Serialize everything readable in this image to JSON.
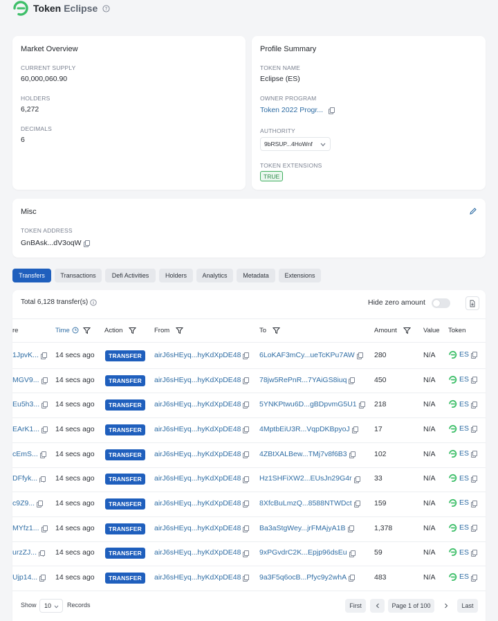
{
  "header": {
    "title_word1": "Token",
    "title_word2": "Eclipse",
    "help_icon": "question-circle-icon"
  },
  "market_overview": {
    "title": "Market Overview",
    "current_supply_label": "CURRENT SUPPLY",
    "current_supply": "60,000,060.90",
    "holders_label": "HOLDERS",
    "holders": "6,272",
    "decimals_label": "DECIMALS",
    "decimals": "6"
  },
  "profile_summary": {
    "title": "Profile Summary",
    "token_name_label": "TOKEN NAME",
    "token_name": "Eclipse (ES)",
    "owner_program_label": "OWNER PROGRAM",
    "owner_program": "Token 2022 Progr...",
    "authority_label": "AUTHORITY",
    "authority": "9bRSUP...4HoWnf",
    "token_extensions_label": "TOKEN EXTENSIONS",
    "token_extensions": "TRUE"
  },
  "misc": {
    "title": "Misc",
    "token_address_label": "TOKEN ADDRESS",
    "token_address": "GnBAsk...dV3oqW"
  },
  "tabs": [
    "Transfers",
    "Transactions",
    "Defi Activities",
    "Holders",
    "Analytics",
    "Metadata",
    "Extensions"
  ],
  "transfers": {
    "total": "Total 6,128 transfer(s)",
    "hide_zero": "Hide zero amount",
    "columns": {
      "signature": "re",
      "time": "Time",
      "action": "Action",
      "from": "From",
      "to": "To",
      "amount": "Amount",
      "value": "Value",
      "token": "Token"
    },
    "rows": [
      {
        "sig": "1JpvK...",
        "time": "14 secs ago",
        "action": "TRANSFER",
        "from": "airJ6sHEyq...hyKdXpDE48",
        "to": "6LoKAF3mCy...ueTcKPu7AW",
        "amount": "280",
        "value": "N/A",
        "token": "ES"
      },
      {
        "sig": "MGV9...",
        "time": "14 secs ago",
        "action": "TRANSFER",
        "from": "airJ6sHEyq...hyKdXpDE48",
        "to": "78jw5RePnR...7YAiGS8iuq",
        "amount": "450",
        "value": "N/A",
        "token": "ES"
      },
      {
        "sig": "Eu5h3...",
        "time": "14 secs ago",
        "action": "TRANSFER",
        "from": "airJ6sHEyq...hyKdXpDE48",
        "to": "5YNKPtwu6D...gBDpvmG5U1",
        "amount": "218",
        "value": "N/A",
        "token": "ES"
      },
      {
        "sig": "EArK1...",
        "time": "14 secs ago",
        "action": "TRANSFER",
        "from": "airJ6sHEyq...hyKdXpDE48",
        "to": "4MptbEiU3R...VqpDKBpyoJ",
        "amount": "17",
        "value": "N/A",
        "token": "ES"
      },
      {
        "sig": "cEmS...",
        "time": "14 secs ago",
        "action": "TRANSFER",
        "from": "airJ6sHEyq...hyKdXpDE48",
        "to": "4ZBtXALBew...TMj7v8f6B3",
        "amount": "102",
        "value": "N/A",
        "token": "ES"
      },
      {
        "sig": "DFfyk...",
        "time": "14 secs ago",
        "action": "TRANSFER",
        "from": "airJ6sHEyq...hyKdXpDE48",
        "to": "Hz1SHFiXW2...EUsJn29G4r",
        "amount": "33",
        "value": "N/A",
        "token": "ES"
      },
      {
        "sig": "c9Z9...",
        "time": "14 secs ago",
        "action": "TRANSFER",
        "from": "airJ6sHEyq...hyKdXpDE48",
        "to": "8XfcBuLmzQ...8588NTWDct",
        "amount": "159",
        "value": "N/A",
        "token": "ES"
      },
      {
        "sig": "MYfz1...",
        "time": "14 secs ago",
        "action": "TRANSFER",
        "from": "airJ6sHEyq...hyKdXpDE48",
        "to": "Ba3aStgWey...jrFMAjyA1B",
        "amount": "1,378",
        "value": "N/A",
        "token": "ES"
      },
      {
        "sig": "urzZJ...",
        "time": "14 secs ago",
        "action": "TRANSFER",
        "from": "airJ6sHEyq...hyKdXpDE48",
        "to": "9xPGvdrC2K...Epjp96dsEu",
        "amount": "59",
        "value": "N/A",
        "token": "ES"
      },
      {
        "sig": "Ujp14...",
        "time": "14 secs ago",
        "action": "TRANSFER",
        "from": "airJ6sHEyq...hyKdXpDE48",
        "to": "9a3F5q6ocB...Pfyc9y2whA",
        "amount": "483",
        "value": "N/A",
        "token": "ES"
      }
    ]
  },
  "pagination": {
    "show": "Show",
    "page_size": "10",
    "records": "Records",
    "first": "First",
    "page_info": "Page 1 of 100",
    "last": "Last"
  },
  "colors": {
    "accent": "#1f5fbd",
    "link": "#2f6da4",
    "logo_green": "#3fbf6a"
  }
}
